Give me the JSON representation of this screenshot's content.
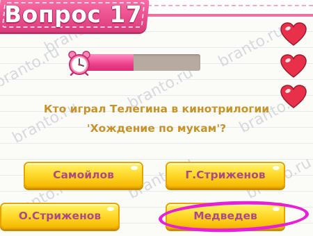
{
  "header": {
    "title": "Вопрос 17"
  },
  "timer": {
    "progress": 0.42
  },
  "lives": {
    "count": 3
  },
  "question": {
    "line1": "Кто играл Телегина в кинотрилогии",
    "line2": "'Хождение по мукам'?"
  },
  "answers": [
    {
      "label": "Самойлов"
    },
    {
      "label": "Г.Стриженов"
    },
    {
      "label": "О.Стриженов"
    },
    {
      "label": "Медведев"
    }
  ],
  "selected_answer": "Медведев",
  "watermark": "branto.ru",
  "colors": {
    "banner": "#ec4f8e",
    "question_text": "#c8922a",
    "answer_text": "#ad4a86",
    "answer_fill": "#ffd92a",
    "highlight": "#e81fd8",
    "timer_fill": "#ee3f8b",
    "timer_track": "#b7aba1"
  }
}
